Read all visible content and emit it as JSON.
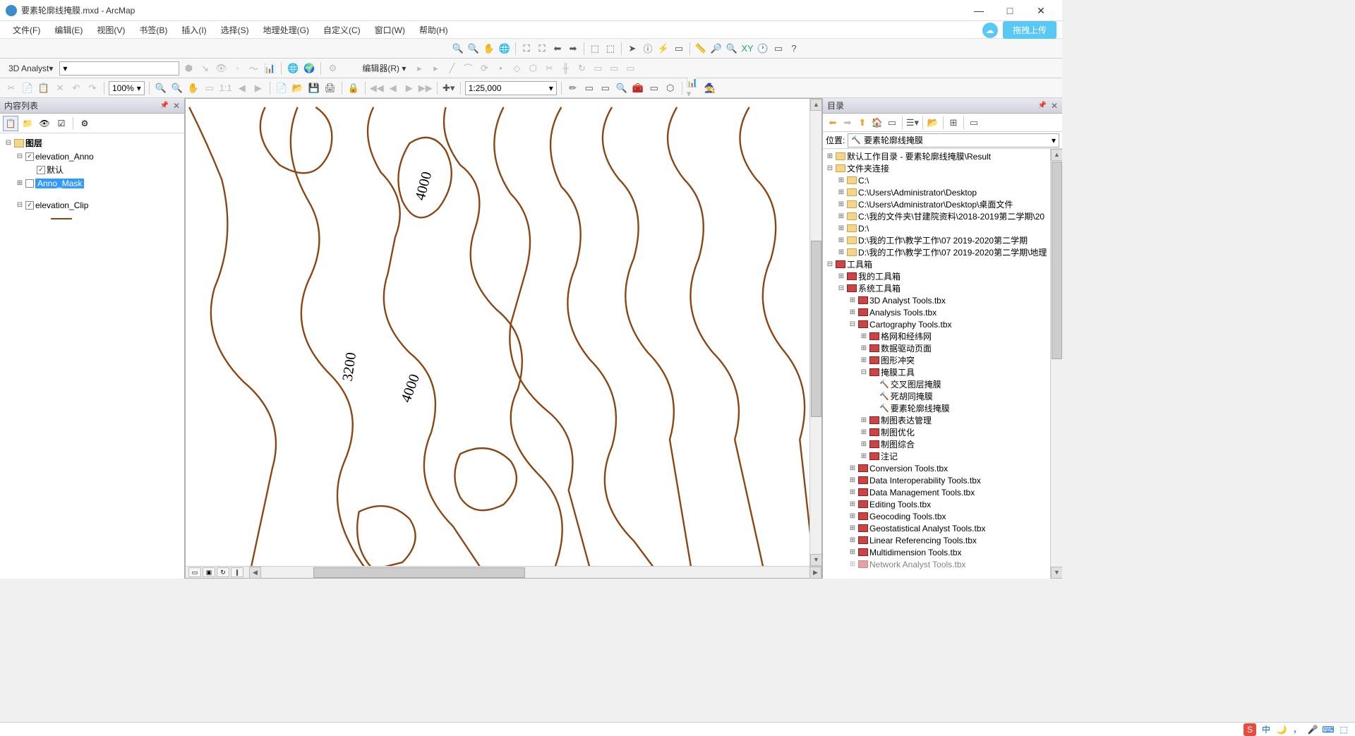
{
  "window": {
    "title": "要素轮廓线掩膜.mxd - ArcMap",
    "minimize": "—",
    "maximize": "□",
    "close": "✕"
  },
  "menubar": {
    "file": "文件(F)",
    "edit": "编辑(E)",
    "view": "视图(V)",
    "bookmarks": "书签(B)",
    "insert": "插入(I)",
    "selection": "选择(S)",
    "geoprocessing": "地理处理(G)",
    "customize": "自定义(C)",
    "windows": "窗口(W)",
    "help": "帮助(H)",
    "upload": "拖拽上传"
  },
  "toolbar2": {
    "analyst_label": "3D Analyst▾",
    "editor_label": "编辑器(R) ▾",
    "zoom_pct": "100%",
    "scale": "1:25,000"
  },
  "toc": {
    "title": "内容列表",
    "root": "图层",
    "layer1": "elevation_Anno",
    "layer1_sub": "默认",
    "layer2": "Anno_Mask",
    "layer3": "elevation_Clip"
  },
  "map": {
    "anno1": "4000",
    "anno2": "3200",
    "anno3": "4000"
  },
  "catalog": {
    "title": "目录",
    "loc_label": "位置:",
    "loc_value": "要素轮廓线掩膜",
    "tree": {
      "default_gdb": "默认工作目录 - 要素轮廓线掩膜\\Result",
      "folder_conn": "文件夹连接",
      "c": "C:\\",
      "c_desktop": "C:\\Users\\Administrator\\Desktop",
      "c_desktop2": "C:\\Users\\Administrator\\Desktop\\桌面文件",
      "c_work": "C:\\我的文件夹\\甘建院资料\\2018-2019第二学期\\20",
      "d": "D:\\",
      "d_work1": "D:\\我的工作\\教学工作\\07 2019-2020第二学期",
      "d_work2": "D:\\我的工作\\教学工作\\07 2019-2020第二学期\\地理",
      "toolboxes": "工具箱",
      "my_tb": "我的工具箱",
      "sys_tb": "系统工具箱",
      "tb_3d": "3D Analyst Tools.tbx",
      "tb_analysis": "Analysis Tools.tbx",
      "tb_carto": "Cartography Tools.tbx",
      "grid": "格网和经纬网",
      "datadriven": "数据驱动页面",
      "conflict": "图形冲突",
      "mask": "掩膜工具",
      "mask1": "交叉图层掩膜",
      "mask2": "死胡同掩膜",
      "mask3": "要素轮廓线掩膜",
      "rep_mgmt": "制图表达管理",
      "carto_opt": "制图优化",
      "carto_gen": "制图综合",
      "anno": "注记",
      "tb_conv": "Conversion Tools.tbx",
      "tb_interop": "Data Interoperability Tools.tbx",
      "tb_datamgmt": "Data Management Tools.tbx",
      "tb_editing": "Editing Tools.tbx",
      "tb_geocode": "Geocoding Tools.tbx",
      "tb_geostat": "Geostatistical Analyst Tools.tbx",
      "tb_linref": "Linear Referencing Tools.tbx",
      "tb_multi": "Multidimension Tools.tbx",
      "tb_network": "Network Analyst Tools.tbx"
    }
  },
  "taskbar": {
    "ime": "中"
  }
}
